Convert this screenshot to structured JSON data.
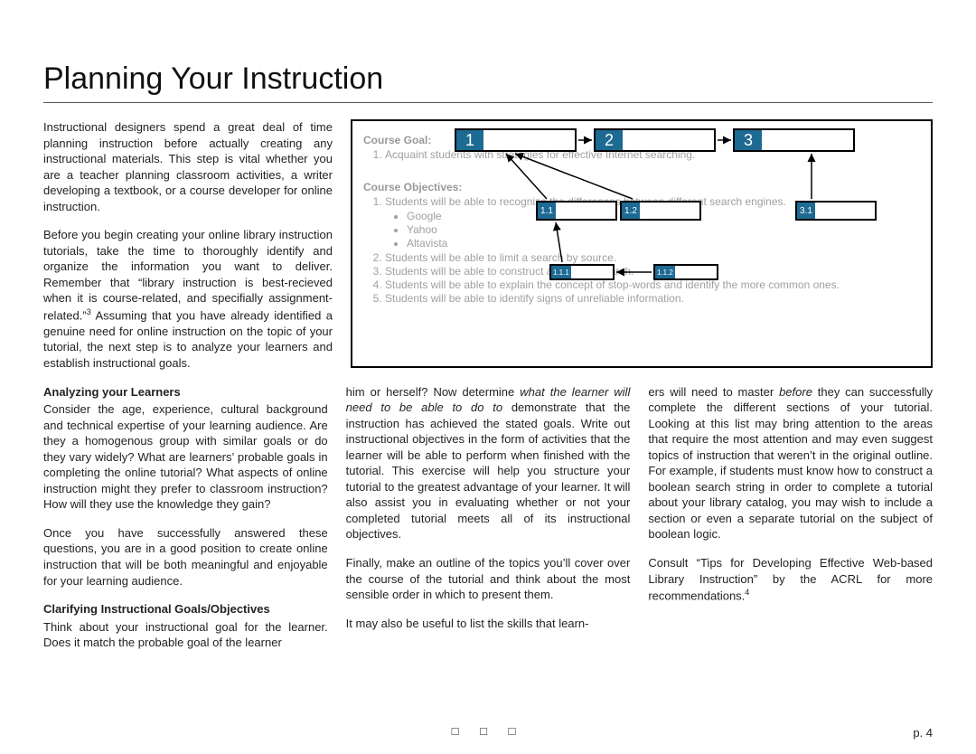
{
  "title": "Planning Your Instruction",
  "intro": {
    "p1": "Instructional designers spend a great deal of time planning instruction before actually creating any instructional materials. This step is vital whether you are a teacher planning classroom activities, a writer developing a textbook, or a course developer for online instruction.",
    "p2a": "Before you begin creating your online library instruction tutorials, take the time to thoroughly identify and organize the information you want to deliver. Remember that “library instruction is best-recieved when it is course-related, and specifially assignment-related.”",
    "p2sup": "3",
    "p2b": " Assuming that you have already identified a genuine need for online instruction on the topic of your tutorial, the next step is to analyze your learners and establish instructional goals."
  },
  "diagram": {
    "goal_label": "Course Goal:",
    "goal_item": "Acquaint students with strategies for effective Internet searching.",
    "obj_label": "Course Objectives:",
    "objs": [
      "Students will be able to recognize the differences between different search engines.",
      "Students will be able to limit a search by source.",
      "Students will be able to construct a Boolean search.",
      "Students will be able to explain the concept of stop-words and identify the more common ones.",
      "Students will be able to identify signs of unreliable information."
    ],
    "engines": [
      "Google",
      "Yahoo",
      "Altavista"
    ],
    "nodes": {
      "n1": "1",
      "n2": "2",
      "n3": "3",
      "n11": "1.1",
      "n12": "1.2",
      "n31": "3.1",
      "n111": "1.1.1",
      "n112": "1.1.2"
    }
  },
  "col_a": {
    "hd1": "Analyzing your Learners",
    "p1": "Consider the age, experience, cultural background and technical expertise of your learning audience. Are they a homogenous group with similar goals or do they vary widely? What are learners’ probable goals in completing the online tutorial? What aspects of online instruction might they prefer to classroom instruction? How will they use the knowledge they gain?",
    "p2": "Once you have successfully answered these questions, you are in a good position to create online instruction that will be both meaningful and enjoyable for your learning audience.",
    "hd2": "Clarifying Instructional Goals/Objectives",
    "p3": "Think about your instructional goal for the learner. Does it match the probable goal of the learner"
  },
  "col_b": {
    "p1a": "him or herself? Now determine ",
    "p1i": "what the learner will need to be able to do to",
    "p1b": " demonstrate that the instruction has achieved the stated goals. Write out instructional objectives in the form of activities that the learner will be able to perform when finished with the tutorial. This exercise will help you structure your tutorial to the greatest advantage of your learner. It will also assist you in evaluating whether or not your completed tutorial meets all of its instructional objectives.",
    "p2": "Finally, make an outline of the topics you’ll cover over the course of the tutorial and think about the most sensible order in which to present them.",
    "p3": "It may also be useful to list the skills that learn-"
  },
  "col_c": {
    "p1a": "ers will need to master ",
    "p1i": "before",
    "p1b": " they can successfully complete the different sections of your tutorial. Looking at this list may bring attention to the areas that require the most attention and may even suggest topics of instruction that weren’t in the original outline. For example, if students must know how to construct a boolean search string in order to complete a tutorial about your library catalog, you may wish to include a section or even a separate tutorial on the subject of boolean logic.",
    "p2a": "Consult “Tips for Developing Effective Web-based Library Instruction” by the ACRL for more recommendations.",
    "p2sup": "4"
  },
  "pagenum": "p. 4",
  "squares": "□ □ □"
}
